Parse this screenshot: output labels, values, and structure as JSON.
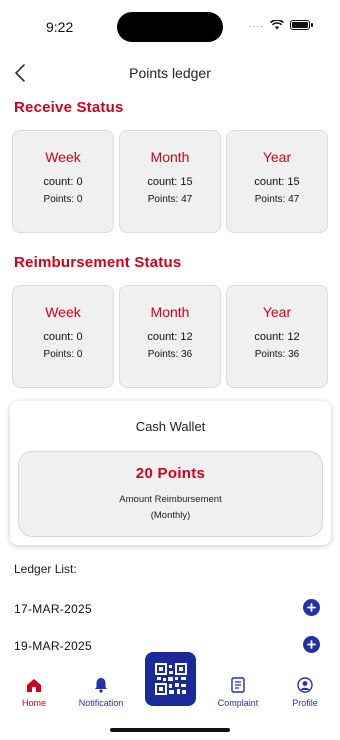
{
  "status_bar": {
    "time": "9:22",
    "signal_dots": "...."
  },
  "header": {
    "title": "Points ledger"
  },
  "receive_status": {
    "title": "Receive Status",
    "cards": [
      {
        "label": "Week",
        "count": "count: 0",
        "points": "Points: 0"
      },
      {
        "label": "Month",
        "count": "count: 15",
        "points": "Points: 47"
      },
      {
        "label": "Year",
        "count": "count: 15",
        "points": "Points: 47"
      }
    ]
  },
  "reimbursement_status": {
    "title": "Reimbursement Status",
    "cards": [
      {
        "label": "Week",
        "count": "count: 0",
        "points": "Points: 0"
      },
      {
        "label": "Month",
        "count": "count: 12",
        "points": "Points: 36"
      },
      {
        "label": "Year",
        "count": "count: 12",
        "points": "Points: 36"
      }
    ]
  },
  "cash_wallet": {
    "title": "Cash Wallet",
    "points": "20 Points",
    "desc_line1": "Amount Reimbursement",
    "desc_line2": "(Monthly)"
  },
  "ledger": {
    "title": "Ledger List:",
    "items": [
      {
        "date": "17-MAR-2025"
      },
      {
        "date": "19-MAR-2025"
      }
    ]
  },
  "bottom_nav": {
    "tabs": [
      {
        "label": "Home",
        "icon": "home-icon",
        "active": true
      },
      {
        "label": "Notification",
        "icon": "bell-icon",
        "active": false
      },
      {
        "label": "Complaint",
        "icon": "complaint-icon",
        "active": false
      },
      {
        "label": "Profile",
        "icon": "profile-icon",
        "active": false
      }
    ],
    "scan_icon": "qr-code-icon"
  },
  "colors": {
    "accent_red": "#d0021b",
    "brand_blue": "#1b2a9a",
    "card_bg": "#f0f0f0"
  }
}
